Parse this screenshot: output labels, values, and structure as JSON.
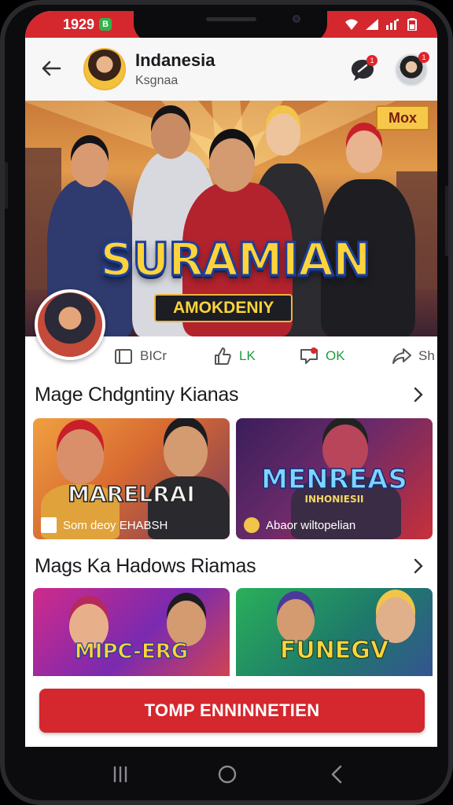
{
  "status_bar": {
    "time": "1929",
    "indicator": "B",
    "icons": [
      "wifi-icon",
      "signal-icon",
      "signal-alt-icon",
      "battery-icon"
    ]
  },
  "header": {
    "title": "Indanesia",
    "subtitle": "Ksgnaa",
    "chat_badge": "1",
    "profile_badge": "1"
  },
  "banner": {
    "corner_badge": "Mox",
    "title": "SURAMIAN",
    "subtitle": "AMOKDENIY"
  },
  "actions": [
    {
      "label": "BICr",
      "icon": "bookmark-icon"
    },
    {
      "label": "LK",
      "icon": "thumb-up-icon"
    },
    {
      "label": "OK",
      "icon": "comment-icon"
    },
    {
      "label": "Sh",
      "icon": "share-icon"
    }
  ],
  "sections": [
    {
      "title": "Mage Chdgntiny Kianas",
      "cards": [
        {
          "logo": "MARELRAI",
          "caption": "Som deoy EHABSH"
        },
        {
          "logo": "MENREAS",
          "logo_sub": "INHONIESII",
          "caption": "Abaor wiltopelian"
        }
      ]
    },
    {
      "title": "Mags Ka Hadows Riamas",
      "cards": [
        {
          "logo": "MIPC-ERG"
        },
        {
          "logo": "FUNEGV"
        }
      ]
    }
  ],
  "cta": {
    "label": "TOMP ENNINNETIEN"
  },
  "nav": [
    "recents-icon",
    "home-icon",
    "back-icon"
  ],
  "colors": {
    "brand_red": "#d4282e",
    "badge_green": "#2fb54a",
    "action_green": "#1f9d3a",
    "banner_gold": "#ffd43a"
  }
}
